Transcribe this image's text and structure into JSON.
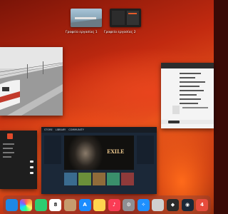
{
  "desktops": [
    {
      "label": "Γραφείο εργασίας 1",
      "bg": "#3c6e8a"
    },
    {
      "label": "Γραφείο εργασίας 2",
      "bg": "#1f1f1f"
    }
  ],
  "steam": {
    "nav_items": [
      "STORE",
      "LIBRARY",
      "COMMUNITY"
    ],
    "game_title": "EXILE"
  },
  "calendar": {
    "date": "8"
  },
  "dock": {
    "badge_count": "4",
    "apps": [
      {
        "name": "finder-icon",
        "color": "#1e88e5"
      },
      {
        "name": "photos-icon",
        "color": "#f5f5f5"
      },
      {
        "name": "facetime-icon",
        "color": "#2ecc71"
      },
      {
        "name": "calendar-icon",
        "color": "#ffffff"
      },
      {
        "name": "contacts-icon",
        "color": "#c69b6d"
      },
      {
        "name": "app-store-icon",
        "color": "#1a8cff"
      },
      {
        "name": "notes-icon",
        "color": "#ffd54f"
      },
      {
        "name": "music-icon",
        "color": "#fa3c55"
      },
      {
        "name": "system-settings-icon",
        "color": "#8e8e93"
      },
      {
        "name": "safari-icon",
        "color": "#1e90ff"
      },
      {
        "name": "preview-icon",
        "color": "#d0d0d0"
      },
      {
        "name": "app-icon",
        "color": "#2a2a2a"
      },
      {
        "name": "steam-icon",
        "color": "#1b2838"
      },
      {
        "name": "badge-app-icon",
        "color": "#e74c3c"
      }
    ]
  }
}
